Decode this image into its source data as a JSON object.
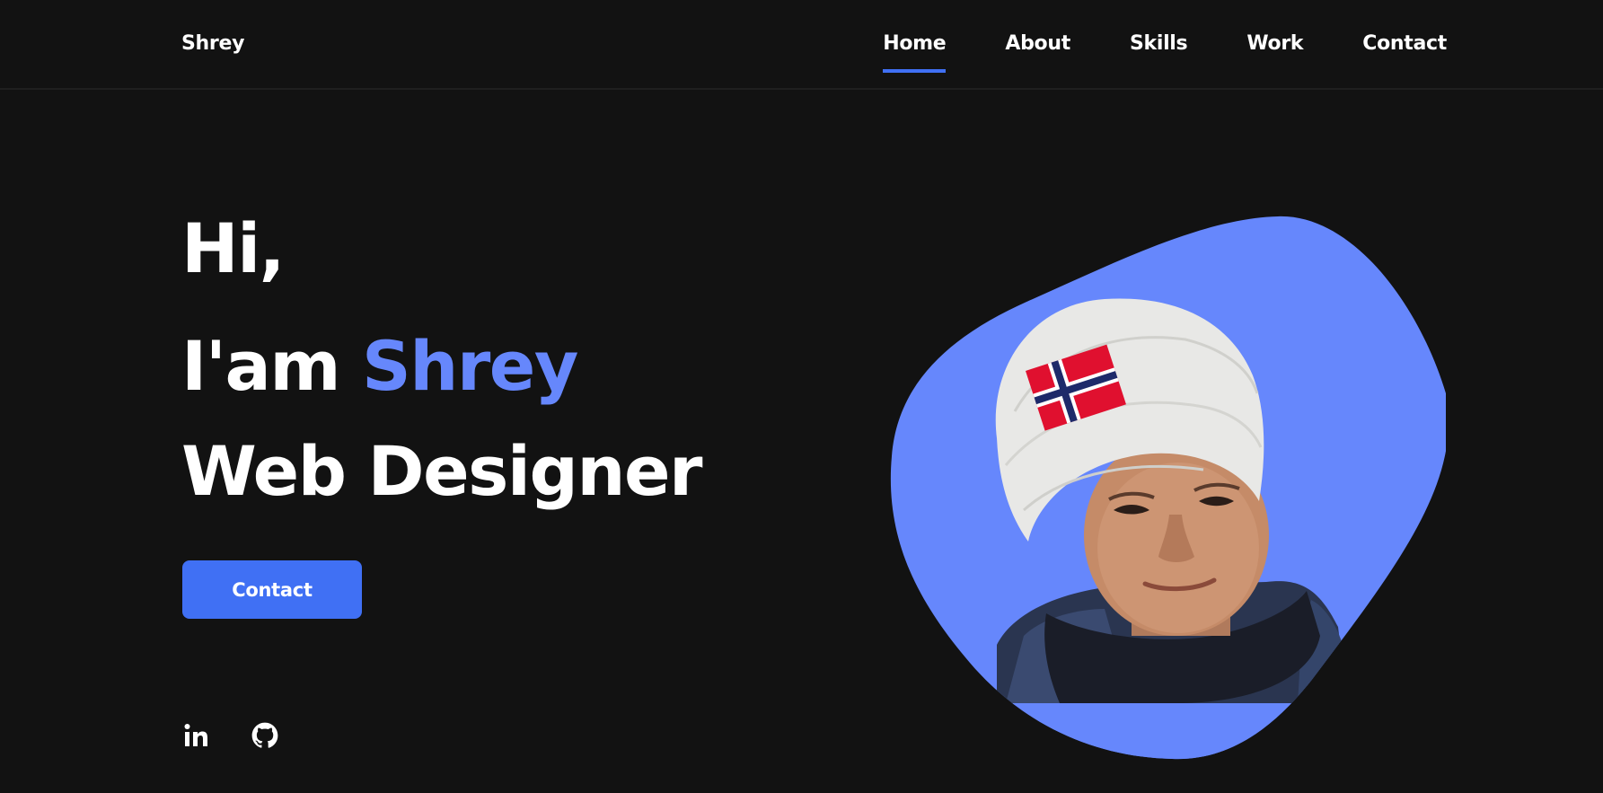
{
  "header": {
    "logo": "Shrey",
    "nav": [
      {
        "label": "Home",
        "active": true
      },
      {
        "label": "About",
        "active": false
      },
      {
        "label": "Skills",
        "active": false
      },
      {
        "label": "Work",
        "active": false
      },
      {
        "label": "Contact",
        "active": false
      }
    ]
  },
  "hero": {
    "greeting": "Hi,",
    "intro_prefix": "I'am ",
    "name": "Shrey",
    "role": "Web Designer",
    "contact_button": "Contact"
  },
  "social": [
    {
      "icon": "linkedin-icon",
      "label": "in"
    },
    {
      "icon": "github-icon"
    }
  ],
  "image": {
    "subject": "portrait-photo",
    "blob_color": "#6687fc"
  },
  "colors": {
    "background": "#121212",
    "accent": "#4070f4",
    "accent_text": "#6687fc",
    "text": "#ffffff"
  }
}
